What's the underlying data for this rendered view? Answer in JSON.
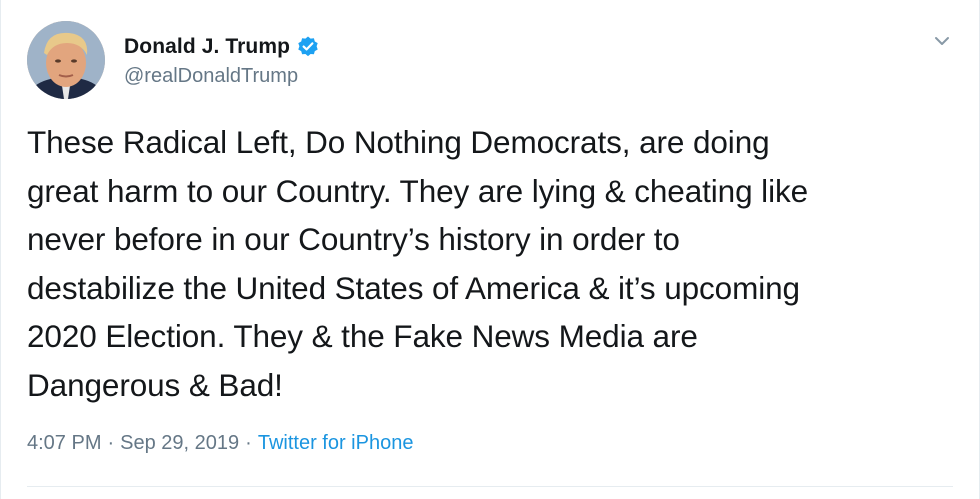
{
  "tweet": {
    "display_name": "Donald J. Trump",
    "handle": "@realDonaldTrump",
    "verified": true,
    "text": "These Radical Left, Do Nothing Democrats, are doing\ngreat harm to our Country. They are lying & cheating like\nnever before in our Country’s history in order to\ndestabilize the United States of America & it’s upcoming\n2020 Election. They & the Fake News Media are\nDangerous & Bad!",
    "time": "4:07 PM",
    "date": "Sep 29, 2019",
    "separator": "·",
    "source": "Twitter for iPhone"
  },
  "icons": {
    "verified": "verified-badge-icon",
    "menu": "chevron-down-icon"
  },
  "colors": {
    "text": "#14171a",
    "secondary": "#657786",
    "link": "#1b95e0",
    "verified": "#1da1f2",
    "border": "#e6ecf0"
  }
}
